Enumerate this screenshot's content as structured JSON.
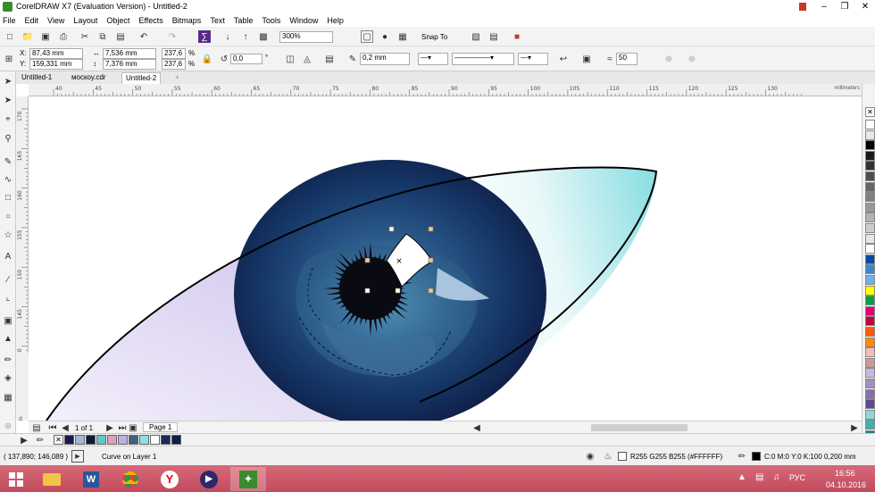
{
  "window": {
    "title": "CorelDRAW X7 (Evaluation Version) - Untitled-2"
  },
  "menu": [
    "File",
    "Edit",
    "View",
    "Layout",
    "Object",
    "Effects",
    "Bitmaps",
    "Text",
    "Table",
    "Tools",
    "Window",
    "Help"
  ],
  "toolbar1": {
    "zoom": "300%",
    "snap_label": "Snap To"
  },
  "propbar": {
    "x_label": "X:",
    "x_value": "87,43 mm",
    "y_label": "Y:",
    "y_value": "159,331 mm",
    "w_value": "7,536 mm",
    "h_value": "7,376 mm",
    "sx_value": "237,6",
    "sy_value": "237,6",
    "pct": "%",
    "rot_value": "0,0",
    "deg": "°",
    "outline_width": "0,2 mm",
    "smooth_value": "50"
  },
  "tabs": [
    "Untitled-1",
    "москоу.cdr",
    "Untitled-2"
  ],
  "ruler": {
    "h_ticks": [
      "40",
      "45",
      "50",
      "55",
      "60",
      "65",
      "70",
      "75",
      "80",
      "85",
      "90",
      "95",
      "100",
      "105",
      "110",
      "115",
      "120",
      "125",
      "130"
    ],
    "h_unit": "millimeters",
    "v_ticks": [
      "170",
      "165",
      "160",
      "155",
      "150",
      "145",
      "140"
    ],
    "v_unit": "millimeters"
  },
  "pagenav": {
    "page_count": "1 of 1",
    "page_name": "Page 1"
  },
  "status": {
    "coords": "( 137,890; 146,089 )",
    "object_info": "Curve on Layer 1",
    "fill_info": "R255 G255 B255 (#FFFFFF)",
    "outline_info": "C:0 M:0 Y:0 K:100  0,200 mm"
  },
  "taskbar": {
    "lang": "РУС",
    "time": "16:56",
    "date": "04.10.2016"
  },
  "colors": {
    "taskbar": "#c24a5e",
    "iris_dark": "#0e1d45",
    "iris_mid": "#2a5a8a",
    "sclera_cyan": "#8fdfe3",
    "sclera_lavender": "#d8d0f0"
  },
  "right_palette": [
    "#ffffff",
    "#e6e6e6",
    "#000000",
    "#1a1a1a",
    "#333333",
    "#4d4d4d",
    "#666666",
    "#808080",
    "#999999",
    "#b3b3b3",
    "#cccccc",
    "#e6e6e6",
    "#ffffff",
    "#0a4aa8",
    "#3a86d0",
    "#6fb0e8",
    "#ffff00",
    "#00a040",
    "#e00070",
    "#c00040",
    "#ff5a00",
    "#ff8a00",
    "#f4c0b0",
    "#cc9999",
    "#c8b8e0",
    "#a090c0",
    "#8870b0",
    "#604890",
    "#90d8d8",
    "#40b0b0",
    "#208080"
  ],
  "doc_palette": [
    "#1a1a4a",
    "#a0b8d0",
    "#0a1a3a",
    "#60c8c8",
    "#e0a0c0",
    "#c0b0e0",
    "#406080",
    "#8fdfe3",
    "#ffffff",
    "#1a2a5a",
    "#0e1d45"
  ]
}
